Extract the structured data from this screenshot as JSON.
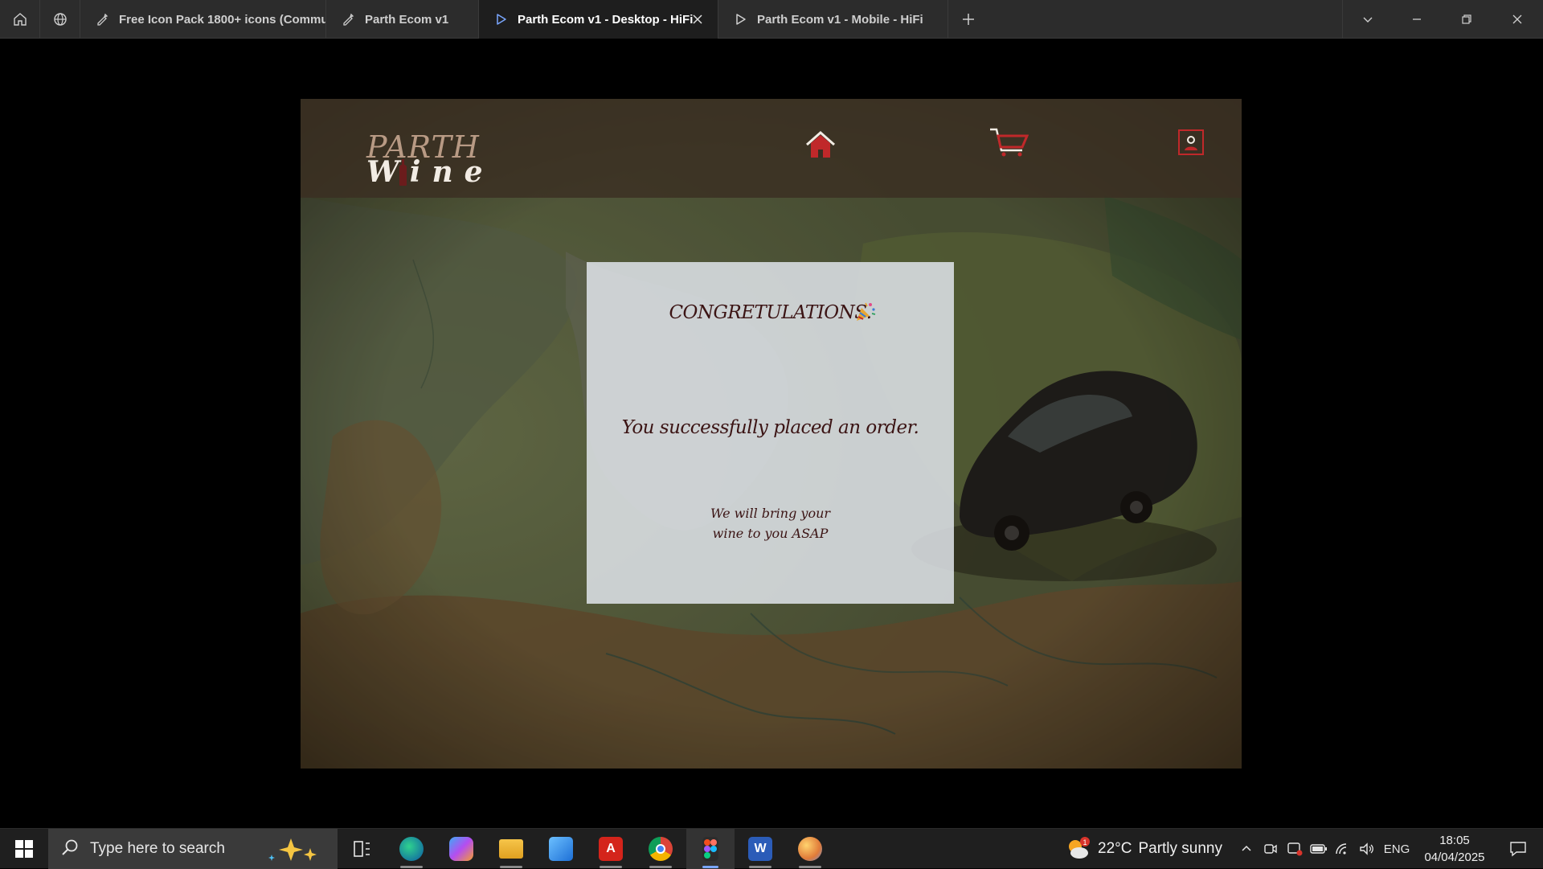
{
  "browser": {
    "tabs": [
      {
        "label": "Free Icon Pack 1800+ icons (Community)",
        "icon": "figma-draft-icon",
        "active": false
      },
      {
        "label": "Parth Ecom v1",
        "icon": "figma-draft-icon",
        "active": false
      },
      {
        "label": "Parth Ecom v1 - Desktop - HiFi",
        "icon": "play-icon",
        "active": true
      },
      {
        "label": "Parth Ecom v1 - Mobile - HiFi",
        "icon": "play-icon",
        "active": false
      }
    ]
  },
  "site": {
    "logo": {
      "line1": "PARTH",
      "line2": "Wine"
    },
    "nav": {
      "home_icon": "home-icon",
      "cart_icon": "cart-icon",
      "account_icon": "user-icon"
    }
  },
  "modal": {
    "title": "CONGRETULATIONS.",
    "title_icon": "party-popper-icon",
    "message": "You successfully placed an order.",
    "note": "We will bring your wine to you ASAP"
  },
  "colors": {
    "header_bg": "#3a2e22",
    "accent_red": "#c0282a",
    "card_bg": "#e0e4ea",
    "card_text": "#3b1414"
  },
  "taskbar": {
    "search_placeholder": "Type here to search",
    "apps": [
      "task-view",
      "edge",
      "copilot",
      "file-explorer",
      "photos",
      "acrobat",
      "chrome",
      "figma",
      "word",
      "paint"
    ],
    "weather": {
      "temp": "22°C",
      "condition": "Partly sunny",
      "alert": "1"
    },
    "language": "ENG",
    "time": "18:05",
    "date": "04/04/2025"
  }
}
